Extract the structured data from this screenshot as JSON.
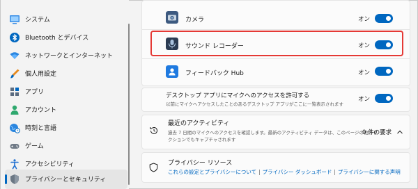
{
  "sidebar": {
    "items": [
      {
        "label": "システム",
        "icon": "monitor-icon"
      },
      {
        "label": "Bluetooth とデバイス",
        "icon": "bluetooth-icon"
      },
      {
        "label": "ネットワークとインターネット",
        "icon": "wifi-icon"
      },
      {
        "label": "個人用設定",
        "icon": "brush-icon"
      },
      {
        "label": "アプリ",
        "icon": "apps-icon"
      },
      {
        "label": "アカウント",
        "icon": "person-icon"
      },
      {
        "label": "時刻と言語",
        "icon": "globe-clock-icon"
      },
      {
        "label": "ゲーム",
        "icon": "gamepad-icon"
      },
      {
        "label": "アクセシビリティ",
        "icon": "accessibility-icon"
      },
      {
        "label": "プライバシーとセキュリティ",
        "icon": "shield-icon"
      }
    ]
  },
  "apps": {
    "camera": {
      "label": "カメラ",
      "state": "オン",
      "icon": "camera-app-icon"
    },
    "recorder": {
      "label": "サウンド レコーダー",
      "state": "オン",
      "icon": "microphone-app-icon"
    },
    "feedback": {
      "label": "フィードバック Hub",
      "state": "オン",
      "icon": "feedback-app-icon"
    }
  },
  "desktop_access": {
    "title": "デスクトップ アプリにマイクへのアクセスを許可する",
    "subtitle": "以前にマイクへアクセスしたことのあるデスクトップ アプリがここに一覧表示されます",
    "state": "オン"
  },
  "recent": {
    "title": "最近のアクティビティ",
    "line1": "過去 7 日間のマイクへのアクセスを確認します。最新のアクティビティ データは、このページの他のセ",
    "line2": "クションでもキャプチャされます",
    "count": "0 件の要求"
  },
  "privacy": {
    "title": "プライバシー リソース",
    "link1": "これらの設定とプライバシーについて",
    "link2": "プライバシー ダッシュボード",
    "link3": "プライバシーに関する声明",
    "separator": "|"
  },
  "colors": {
    "accent": "#0067c0",
    "highlight": "#e53935"
  }
}
